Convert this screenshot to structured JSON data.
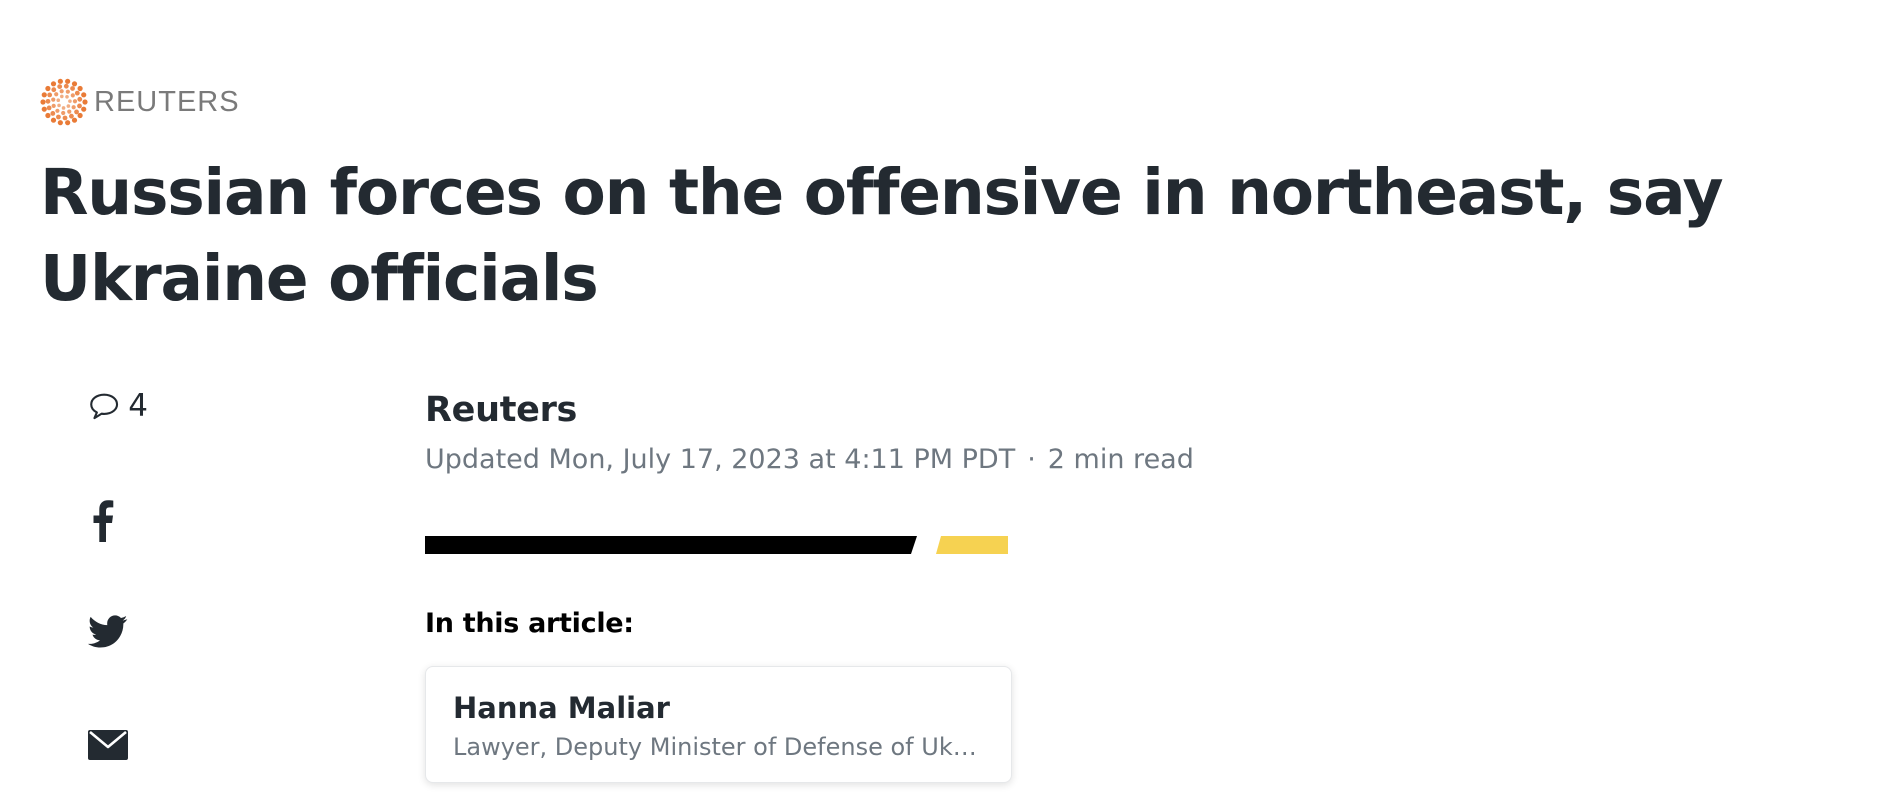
{
  "brand": {
    "name": "REUTERS",
    "logo_icon": "reuters-dots-logo",
    "logo_color": "#e8742c"
  },
  "headline": "Russian forces on the offensive in northeast, say Ukraine officials",
  "share": {
    "comments_icon": "speech-bubble-icon",
    "comment_count": "4",
    "facebook_icon": "facebook-icon",
    "twitter_icon": "twitter-bird-icon",
    "email_icon": "email-envelope-icon"
  },
  "byline": {
    "author": "Reuters",
    "updated": "Updated Mon, July 17, 2023 at 4:11 PM PDT",
    "separator": "·",
    "read_time": "2 min read"
  },
  "decor": {
    "stripe_dark": "#000000",
    "stripe_accent": "#f6d251"
  },
  "in_this_article": {
    "label": "In this article:",
    "card": {
      "name": "Hanna Maliar",
      "description": "Lawyer, Deputy Minister of Defense of Ukraine"
    }
  }
}
